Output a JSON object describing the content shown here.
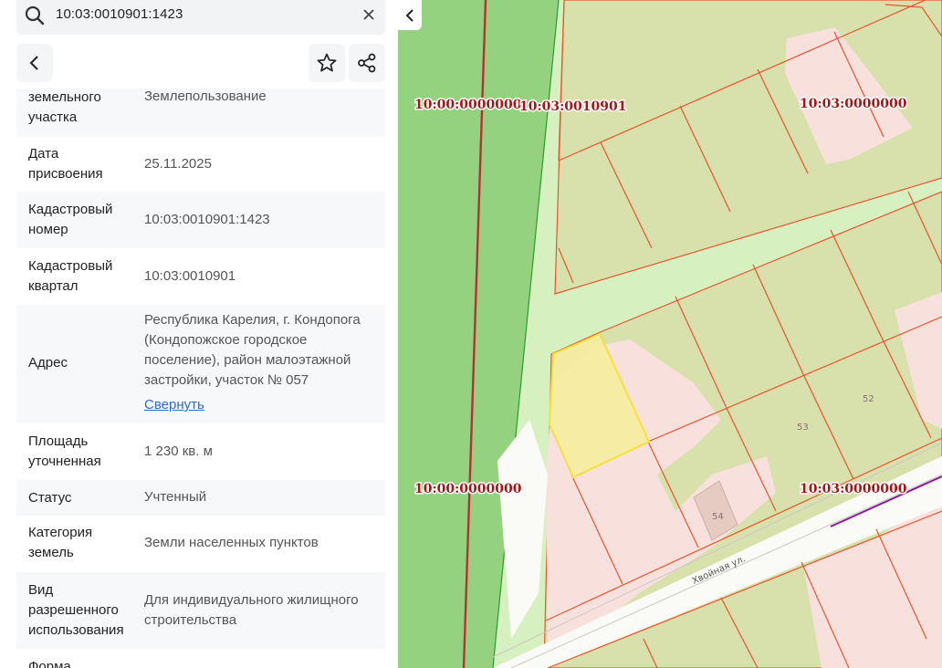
{
  "search": {
    "value": "10:03:0010901:1423",
    "search_icon": "search-icon",
    "clear_icon": "close-icon"
  },
  "toolbar": {
    "back_icon": "chevron-left-icon",
    "favorite_icon": "star-icon",
    "share_icon": "share-icon"
  },
  "details": [
    {
      "label_lines": [
        "земельного",
        "участка"
      ],
      "value_lines": [
        "Землепользование"
      ]
    },
    {
      "label_lines": [
        "Дата",
        "присвоения"
      ],
      "value_lines": [
        "25.11.2025"
      ]
    },
    {
      "label_lines": [
        "Кадастровый",
        "номер"
      ],
      "value_lines": [
        "10:03:0010901:1423"
      ]
    },
    {
      "label_lines": [
        "Кадастровый",
        "квартал"
      ],
      "value_lines": [
        "10:03:0010901"
      ]
    },
    {
      "label_lines": [
        "Адрес"
      ],
      "value_lines": [
        "Республика Карелия, г. Кондопога",
        "(Кондопожское городское",
        "поселение), район малоэтажной",
        "застройки, участок № 057"
      ],
      "link": "Свернуть"
    },
    {
      "label_lines": [
        "Площадь",
        "уточненная"
      ],
      "value_lines": [
        "1 230 кв. м"
      ]
    },
    {
      "label_lines": [
        "Статус"
      ],
      "value_lines": [
        "Учтенный"
      ]
    },
    {
      "label_lines": [
        "Категория",
        "земель"
      ],
      "value_lines": [
        "Земли населенных пунктов"
      ]
    },
    {
      "label_lines": [
        "Вид",
        "разрешенного",
        "использования"
      ],
      "value_lines": [
        "Для индивидуального жилищного",
        "строительства"
      ]
    },
    {
      "label_lines": [
        "Форма"
      ],
      "value_lines": []
    }
  ],
  "map": {
    "collapse_icon": "chevron-left-icon",
    "labels": {
      "q1": "10:00:0000000",
      "q2": "10:03:0010901",
      "q3": "10:03:0000000",
      "q4": "10:00:0000000",
      "q5": "10:03:0000000"
    },
    "parcel_numbers": {
      "p52": "52",
      "p53": "53",
      "p54": "54"
    },
    "street": "Хвойная ул.",
    "colors": {
      "forest": "#95d27f",
      "light_green": "#d6f0c0",
      "parcel_fill": "#d8e0ac",
      "pink": "#f8e0dc",
      "border": "#e8552f",
      "selected": "#f5ed9e",
      "label": "#a01818"
    }
  }
}
